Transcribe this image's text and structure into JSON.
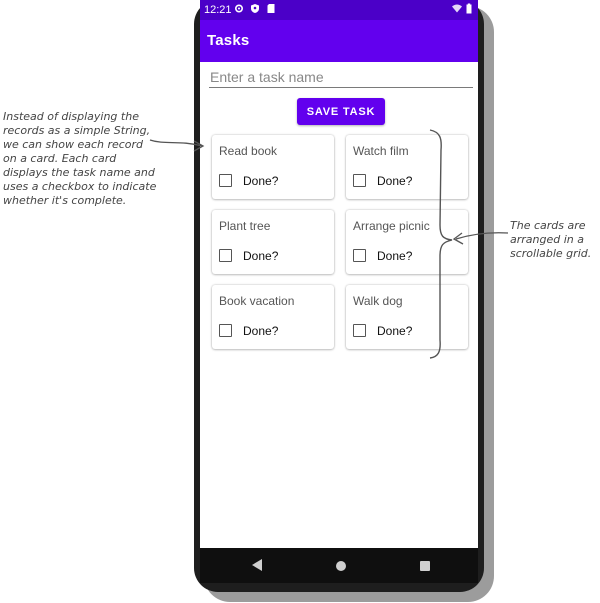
{
  "status_bar": {
    "time": "12:21",
    "left_icons": [
      "gear-icon",
      "shield-icon",
      "sim-card-icon"
    ],
    "right_icons": [
      "wifi-icon",
      "battery-icon"
    ]
  },
  "app_bar": {
    "title": "Tasks"
  },
  "form": {
    "task_placeholder": "Enter a task name",
    "task_value": "",
    "save_label": "SAVE TASK"
  },
  "tasks": [
    {
      "name": "Read book",
      "done_label": "Done?",
      "done": false
    },
    {
      "name": "Watch film",
      "done_label": "Done?",
      "done": false
    },
    {
      "name": "Plant tree",
      "done_label": "Done?",
      "done": false
    },
    {
      "name": "Arrange picnic",
      "done_label": "Done?",
      "done": false
    },
    {
      "name": "Book vacation",
      "done_label": "Done?",
      "done": false
    },
    {
      "name": "Walk dog",
      "done_label": "Done?",
      "done": false
    }
  ],
  "nav_bar": {
    "icons": [
      "back-icon",
      "home-icon",
      "recents-icon"
    ]
  },
  "annotations": {
    "left": "Instead of displaying the\nrecords as a simple String,\nwe can show each record\non a card. Each card\ndisplays the task name and\nuses a checkbox to indicate\nwhether it's complete.",
    "right": "The cards are\narranged in a\nscrollable grid."
  },
  "colors": {
    "primary": "#6200ee",
    "status_bar": "#4b00c8",
    "nav_bar": "#0f0f0f",
    "annotation_ink": "#444444"
  }
}
